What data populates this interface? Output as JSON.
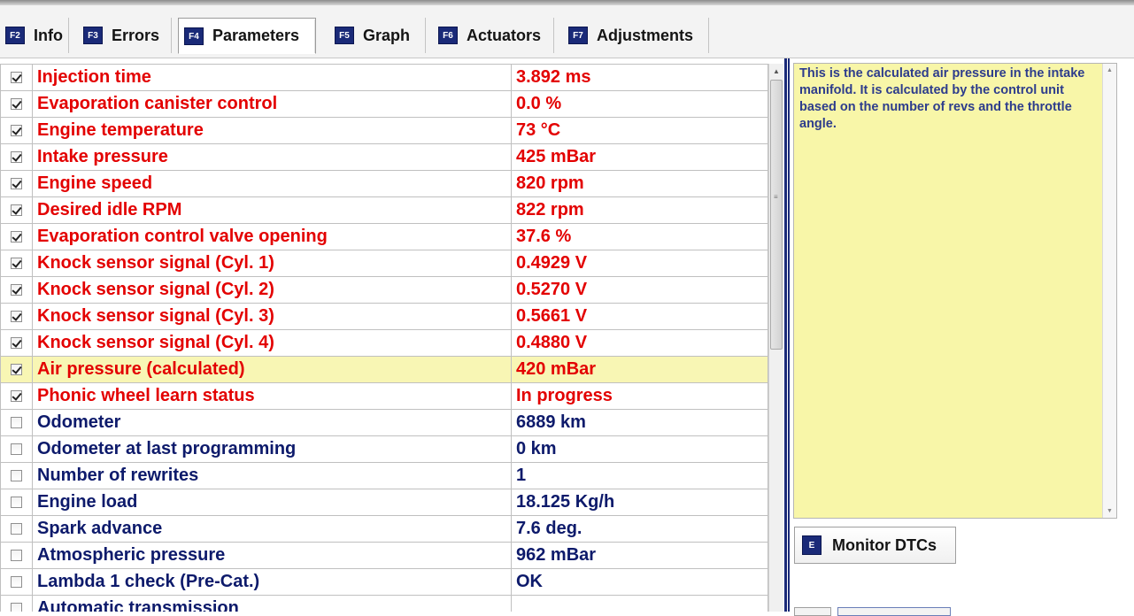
{
  "tabs": [
    {
      "key": "F2",
      "label": "Info"
    },
    {
      "key": "F3",
      "label": "Errors"
    },
    {
      "key": "F4",
      "label": "Parameters",
      "active": true
    },
    {
      "key": "F5",
      "label": "Graph"
    },
    {
      "key": "F6",
      "label": "Actuators"
    },
    {
      "key": "F7",
      "label": "Adjustments"
    }
  ],
  "parameters": [
    {
      "checked": true,
      "name": "Injection time",
      "value": "3.892 ms"
    },
    {
      "checked": true,
      "name": "Evaporation canister control",
      "value": "0.0 %"
    },
    {
      "checked": true,
      "name": "Engine temperature",
      "value": "73 °C"
    },
    {
      "checked": true,
      "name": "Intake pressure",
      "value": "425 mBar"
    },
    {
      "checked": true,
      "name": "Engine speed",
      "value": "820 rpm"
    },
    {
      "checked": true,
      "name": "Desired idle RPM",
      "value": "822 rpm"
    },
    {
      "checked": true,
      "name": "Evaporation control valve opening",
      "value": "37.6 %"
    },
    {
      "checked": true,
      "name": "Knock sensor signal (Cyl. 1)",
      "value": "0.4929 V"
    },
    {
      "checked": true,
      "name": "Knock sensor signal (Cyl. 2)",
      "value": "0.5270 V"
    },
    {
      "checked": true,
      "name": "Knock sensor signal (Cyl. 3)",
      "value": "0.5661 V"
    },
    {
      "checked": true,
      "name": "Knock sensor signal (Cyl. 4)",
      "value": "0.4880 V"
    },
    {
      "checked": true,
      "name": "Air pressure (calculated)",
      "value": "420 mBar",
      "selected": true
    },
    {
      "checked": true,
      "name": "Phonic wheel learn status",
      "value": "In progress"
    },
    {
      "checked": false,
      "name": "Odometer",
      "value": "6889 km"
    },
    {
      "checked": false,
      "name": "Odometer at last programming",
      "value": "0 km"
    },
    {
      "checked": false,
      "name": "Number of rewrites",
      "value": "1"
    },
    {
      "checked": false,
      "name": "Engine load",
      "value": "18.125 Kg/h"
    },
    {
      "checked": false,
      "name": "Spark advance",
      "value": "7.6 deg."
    },
    {
      "checked": false,
      "name": "Atmospheric pressure",
      "value": "962 mBar"
    },
    {
      "checked": false,
      "name": "Lambda 1 check (Pre-Cat.)",
      "value": "OK"
    },
    {
      "checked": false,
      "name": "Automatic transmission",
      "value": ""
    }
  ],
  "info_panel": {
    "text": "This is the calculated air pressure in the intake manifold. It is calculated by the control unit based on the number of revs and the throttle angle."
  },
  "monitor_button": {
    "key": "E",
    "label": "Monitor DTCs"
  },
  "colors": {
    "active_param": "#e30000",
    "inactive_param": "#0d1a6b",
    "selected_row_bg": "#f8f6b4",
    "info_bg": "#f8f6a8",
    "fkey_badge": "#1a2a78"
  }
}
